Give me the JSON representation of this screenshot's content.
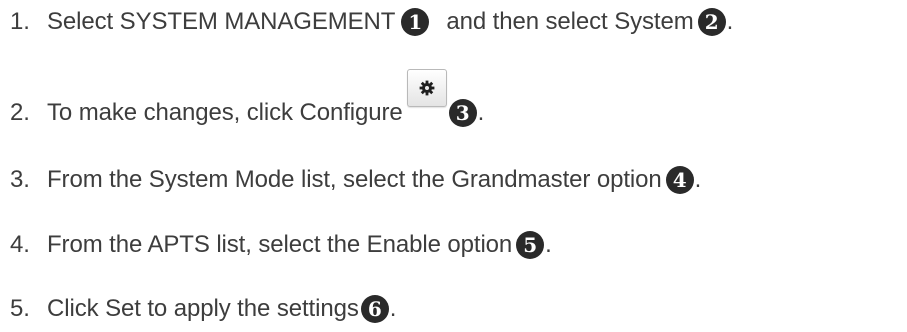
{
  "steps": [
    {
      "number": "1.",
      "text_before": "Select SYSTEM MANAGEMENT",
      "marker": "1",
      "text_middle": "and then select System",
      "marker2": "2",
      "text_after": "."
    },
    {
      "number": "2.",
      "text_before": "To make changes, click Configure",
      "button_icon": "gear-icon",
      "marker": "3",
      "text_after": "."
    },
    {
      "number": "3.",
      "text_before": "From the System Mode list, select the Grandmaster option",
      "marker": "4",
      "text_after": "."
    },
    {
      "number": "4.",
      "text_before": "From the APTS list, select the Enable option",
      "marker": "5",
      "text_after": "."
    },
    {
      "number": "5.",
      "text_before": "Click Set to apply the settings",
      "marker": "6",
      "text_after": "."
    }
  ],
  "colors": {
    "text": "#3d3d3d",
    "marker_fill": "#2a2a2a",
    "marker_text": "#ffffff",
    "button_border": "#b9b9b9",
    "gear": "#1f1f1f"
  }
}
